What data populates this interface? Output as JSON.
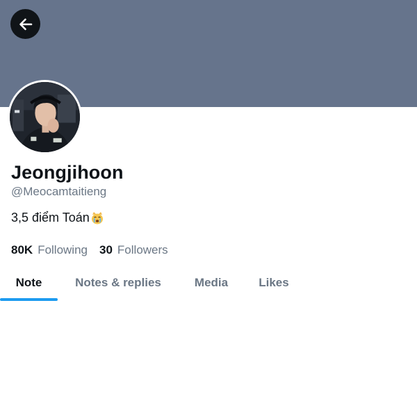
{
  "profile": {
    "display_name": "Jeongjihoon",
    "handle": "@Meocamtaitieng",
    "bio_text": "3,5 điểm Toán",
    "bio_emoji": "crying-cat-emoji",
    "banner_color": "#66748c"
  },
  "stats": {
    "following_count": "80K",
    "following_label": "Following",
    "followers_count": "30",
    "followers_label": "Followers"
  },
  "tabs": [
    {
      "label": "Note",
      "active": true
    },
    {
      "label": "Notes & replies",
      "active": false
    },
    {
      "label": "Media",
      "active": false
    },
    {
      "label": "Likes",
      "active": false
    }
  ],
  "colors": {
    "accent": "#1d9bf0",
    "text_primary": "#0f1419",
    "text_secondary": "#6b7785"
  },
  "icons": {
    "back": "arrow-left-icon"
  }
}
